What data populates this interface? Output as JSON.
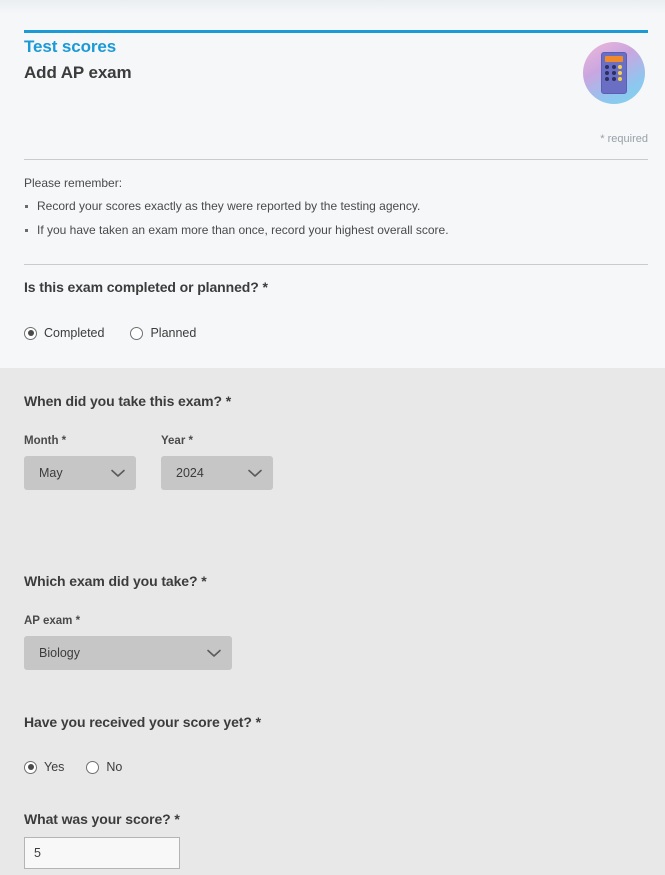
{
  "header": {
    "eyebrow": "Test scores",
    "title": "Add AP exam",
    "required_note": "* required",
    "accent_color": "#1b9ad6",
    "badge_icon": "calculator-icon"
  },
  "remember": {
    "lead": "Please remember:",
    "items": [
      "Record your scores exactly as they were reported by the testing agency.",
      "If you have taken an exam more than once, record your highest overall score."
    ]
  },
  "questions": {
    "completed_or_planned": {
      "label": "Is this exam completed or planned? *",
      "options": [
        {
          "label": "Completed",
          "selected": true
        },
        {
          "label": "Planned",
          "selected": false
        }
      ]
    },
    "when_taken": {
      "label": "When did you take this exam? *",
      "month": {
        "label": "Month *",
        "value": "May"
      },
      "year": {
        "label": "Year *",
        "value": "2024"
      }
    },
    "which_exam": {
      "label": "Which exam did you take? *",
      "ap_exam": {
        "label": "AP exam *",
        "value": "Biology"
      }
    },
    "received_score": {
      "label": "Have you received your score yet? *",
      "options": [
        {
          "label": "Yes",
          "selected": true
        },
        {
          "label": "No",
          "selected": false
        }
      ]
    },
    "score": {
      "label": "What was your score? *",
      "value": "5",
      "placeholder": ""
    }
  }
}
